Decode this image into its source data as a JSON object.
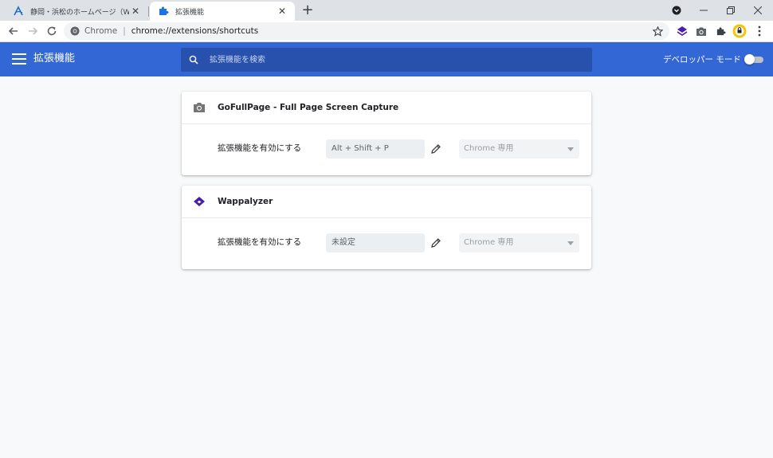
{
  "tabs": [
    {
      "title": "静岡・浜松のホームページ（Webサイ",
      "active": false,
      "icon": "site-logo-icon"
    },
    {
      "title": "拡張機能",
      "active": true,
      "icon": "puzzle-icon"
    }
  ],
  "toolbar": {
    "omnibox_label": "Chrome",
    "url": "chrome://extensions/shortcuts"
  },
  "header": {
    "title": "拡張機能",
    "search_placeholder": "拡張機能を検索",
    "devmode_label": "デベロッパー モード",
    "devmode_on": false
  },
  "extensions": [
    {
      "name": "GoFullPage - Full Page Screen Capture",
      "icon": "camera-icon",
      "command_label": "拡張機能を有効にする",
      "shortcut": "Alt + Shift + P",
      "scope": "Chrome 専用"
    },
    {
      "name": "Wappalyzer",
      "icon": "wappalyzer-icon",
      "command_label": "拡張機能を有効にする",
      "shortcut": "未設定",
      "scope": "Chrome 専用"
    }
  ],
  "colors": {
    "header": "#3367d6",
    "search": "#2850ad",
    "tabbar": "#dee1e6",
    "wappalyzer": "#4a1fa8"
  }
}
